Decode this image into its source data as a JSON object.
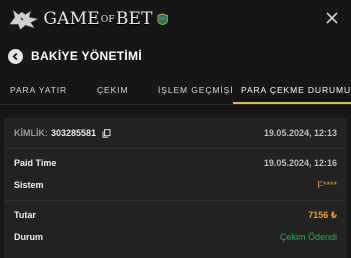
{
  "header": {
    "logo_text_main": "GAME",
    "logo_text_of": "OF",
    "logo_text_end": "BET"
  },
  "nav": {
    "title": "BAKİYE YÖNETİMİ"
  },
  "tabs": [
    {
      "label": "PARA YATIR",
      "active": false
    },
    {
      "label": "ÇEKIM",
      "active": false
    },
    {
      "label": "İŞLEM GEÇMİŞİ",
      "active": false
    },
    {
      "label": "PARA ÇEKME DURUMU",
      "active": true
    }
  ],
  "transaction": {
    "id_label": "KİMLİK:",
    "id_value": "303285581",
    "created": "19.05.2024, 12:13",
    "paid_time_label": "Paid Time",
    "paid_time_value": "19.05.2024, 12:16",
    "system_label": "Sistem",
    "system_value": "F****",
    "amount_label": "Tutar",
    "amount_value": "7156 ₺",
    "status_label": "Durum",
    "status_value": "Çekim Ödendi"
  },
  "colors": {
    "accent": "#e0b94a",
    "amount": "#f0a020",
    "status_success": "#23b35a",
    "background": "#161616",
    "card": "#222222"
  }
}
